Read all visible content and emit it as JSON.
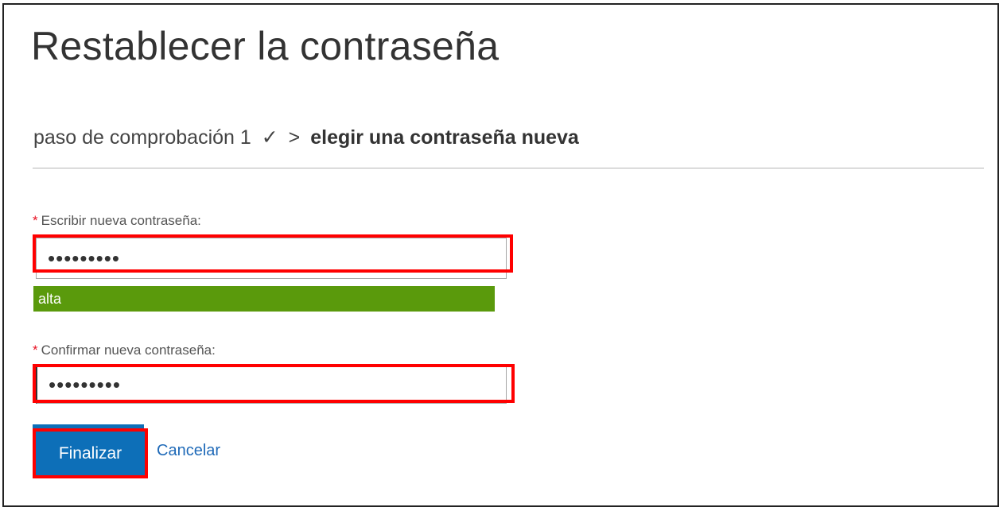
{
  "page": {
    "title": "Restablecer la contraseña"
  },
  "breadcrumb": {
    "step_done": "paso de comprobación 1",
    "check_mark": "✓",
    "separator": ">",
    "current_step": "elegir una contraseña nueva"
  },
  "form": {
    "required_marker": "*",
    "new_password": {
      "label": "Escribir nueva contraseña:",
      "value": "•••••••••"
    },
    "strength": {
      "label": "alta",
      "color": "#5a9a0c"
    },
    "confirm_password": {
      "label": "Confirmar nueva contraseña:",
      "value": "•••••••••"
    }
  },
  "actions": {
    "finish_label": "Finalizar",
    "cancel_label": "Cancelar"
  },
  "colors": {
    "primary_button": "#0d6fb8",
    "highlight": "#ff0000",
    "link": "#1f6ab8"
  }
}
